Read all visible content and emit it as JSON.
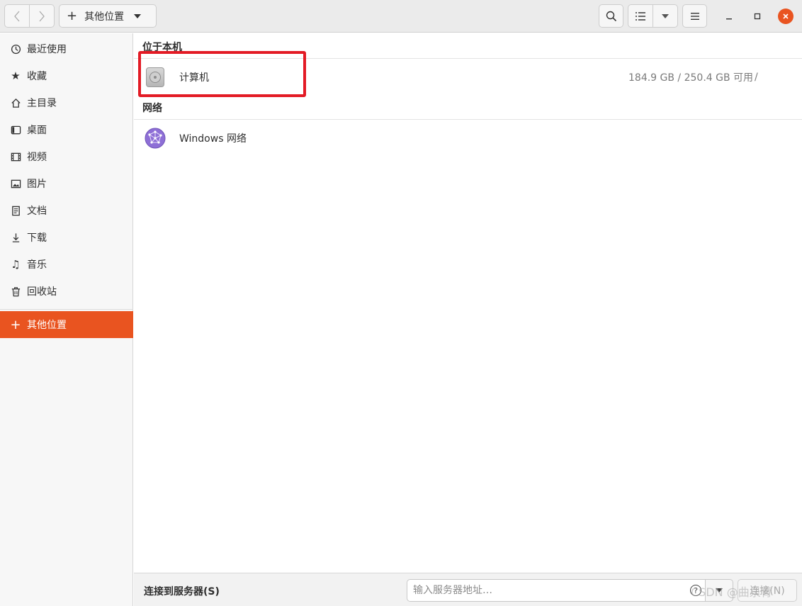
{
  "header": {
    "path_label": "其他位置",
    "icons": {
      "back": "chevron-left-icon",
      "forward": "chevron-right-icon",
      "search": "search-icon",
      "list_view": "list-view-icon",
      "menu": "hamburger-menu-icon"
    }
  },
  "sidebar": {
    "items": [
      {
        "label": "最近使用",
        "icon": "clock-icon"
      },
      {
        "label": "收藏",
        "icon": "star-icon"
      },
      {
        "label": "主目录",
        "icon": "home-icon"
      },
      {
        "label": "桌面",
        "icon": "desktop-icon"
      },
      {
        "label": "视频",
        "icon": "video-icon"
      },
      {
        "label": "图片",
        "icon": "picture-icon"
      },
      {
        "label": "文档",
        "icon": "document-icon"
      },
      {
        "label": "下载",
        "icon": "download-icon"
      },
      {
        "label": "音乐",
        "icon": "music-icon"
      },
      {
        "label": "回收站",
        "icon": "trash-icon"
      }
    ],
    "other_locations": {
      "label": "其他位置",
      "icon": "plus-icon"
    }
  },
  "main": {
    "local_section": {
      "title": "位于本机",
      "computer": {
        "name": "计算机",
        "info": "184.9 GB / 250.4 GB 可用",
        "mount": "/"
      }
    },
    "network_section": {
      "title": "网络",
      "windows": {
        "name": "Windows 网络"
      }
    }
  },
  "bottom": {
    "connect_label": "连接到服务器(S)",
    "server_placeholder": "输入服务器地址…",
    "connect_button": "连接(N)"
  },
  "watermark": "CSDN @曲泉青",
  "colors": {
    "accent": "#e95420",
    "highlight_box": "#e31b25"
  }
}
